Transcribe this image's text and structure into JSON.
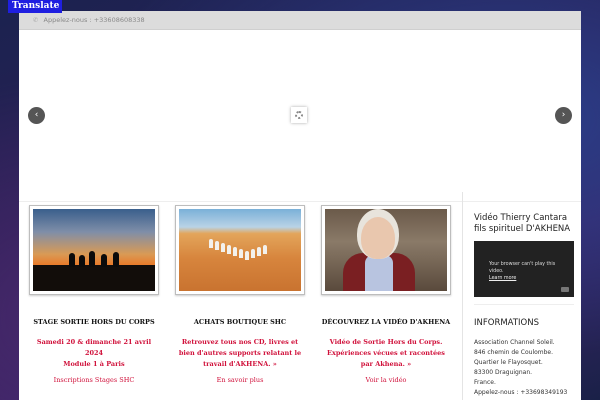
{
  "translate_label": "Translate",
  "topbar": {
    "phone_icon": "phone-icon",
    "phone_text": "Appelez-nous : +33608608338"
  },
  "slider": {
    "prev_icon": "‹",
    "next_icon": "›"
  },
  "columns": [
    {
      "heading": "STAGE SORTIE HORS DU CORPS",
      "highlight": "Samedi 20 & dimanche 21 avril 2024\nModule 1 à Paris",
      "link": "Inscriptions Stages SHC"
    },
    {
      "heading": "ACHATS BOUTIQUE SHC",
      "highlight": "Retrouvez tous nos CD, livres et bien d'autres supports relatant le travail d'AKHENA. »",
      "link": "En savoir plus"
    },
    {
      "heading": "DÉCOUVREZ LA VIDÉO D'AKHENA",
      "highlight": "Vidéo de Sortie Hors du Corps. Expériences vécues et racontées par Akhena. »",
      "link": "Voir la vidéo"
    }
  ],
  "sidebar": {
    "video_title": "Vidéo Thierry Cantara fils spirituel D'AKHENA",
    "video_message_1": "Your browser can't play this",
    "video_message_2": "video.",
    "video_learn_more": "Learn more",
    "info_title": "INFORMATIONS",
    "info_lines": [
      "Association Channel Soleil.",
      "846 chemin de Coulombe.",
      "Quartier le Flayosquet.",
      "83300 Draguignan.",
      "France.",
      "Appelez-nous : +33698349193"
    ]
  },
  "colors": {
    "accent_red": "#d0103a",
    "translate_blue": "#1f1fe0"
  }
}
